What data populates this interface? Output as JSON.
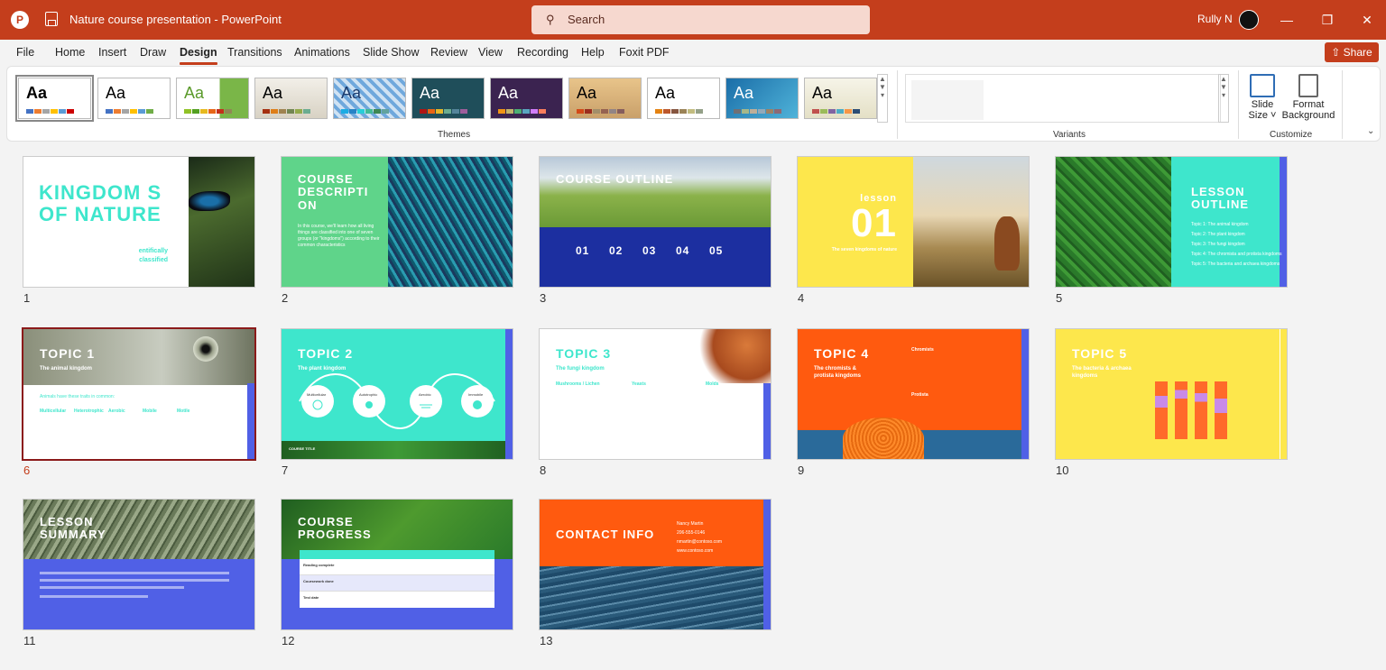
{
  "window": {
    "title": "Nature course presentation  -  PowerPoint",
    "user": "Rully N",
    "search_placeholder": "Search"
  },
  "tabs": [
    "File",
    "Home",
    "Insert",
    "Draw",
    "Design",
    "Transitions",
    "Animations",
    "Slide Show",
    "Review",
    "View",
    "Recording",
    "Help",
    "Foxit PDF"
  ],
  "active_tab": "Design",
  "share_label": "Share",
  "ribbon": {
    "themes_label": "Themes",
    "variants_label": "Variants",
    "customize_label": "Customize",
    "slide_size_label1": "Slide",
    "slide_size_label2": "Size",
    "format_bg_label1": "Format",
    "format_bg_label2": "Background",
    "theme_glyph": "Aa"
  },
  "slides": {
    "s1": {
      "num": "1",
      "title": "KINGDOM S OF NATURE",
      "sub": "entifically classified"
    },
    "s2": {
      "num": "2",
      "title": "COURSE DESCRIPTI ON",
      "body": "In this course, we'll learn how all living things are classified into one of seven groups (or \"kingdoms\") according to their common characteristics"
    },
    "s3": {
      "num": "3",
      "title": "COURSE OUTLINE",
      "items": [
        "01",
        "02",
        "03",
        "04",
        "05"
      ]
    },
    "s4": {
      "num": "4",
      "label": "lesson",
      "number": "01",
      "sub": "The seven kingdoms of nature"
    },
    "s5": {
      "num": "5",
      "title": "LESSON OUTLINE",
      "items": [
        "Topic 1: The animal kingdom",
        "Topic 2: The plant kingdom",
        "Topic 3: The fungi kingdom",
        "Topic 4: The chromista and protista kingdoms",
        "Topic 5: The bacteria and archaea kingdoms"
      ]
    },
    "s6": {
      "num": "6",
      "title": "TOPIC 1",
      "sub": "The animal kingdom",
      "intro": "Animals have these traits in common:",
      "cols": [
        "Multicellular",
        "Heterotrophic",
        "Aerobic",
        "Mobile",
        "Motile"
      ]
    },
    "s7": {
      "num": "7",
      "title": "TOPIC 2",
      "sub": "The plant kingdom",
      "circles": [
        "Multicellular",
        "Autotrophic",
        "Aerobic",
        "Immobile"
      ],
      "footer": "COURSE TITLE"
    },
    "s8": {
      "num": "8",
      "title": "TOPIC 3",
      "sub": "The fungi kingdom",
      "cols": [
        "Mushrooms / Lichen",
        "Yeasts",
        "Molds"
      ]
    },
    "s9": {
      "num": "9",
      "title": "TOPIC 4",
      "sub": "The chromists & protista kingdoms",
      "items": [
        "Chromists",
        "Protista"
      ]
    },
    "s10": {
      "num": "10",
      "title": "TOPIC 5",
      "sub": "The bacteria & archaea kingdoms"
    },
    "s11": {
      "num": "11",
      "title": "LESSON SUMMARY"
    },
    "s12": {
      "num": "12",
      "title": "COURSE PROGRESS",
      "rows": [
        "Reading complete",
        "Coursework done",
        "Test date"
      ]
    },
    "s13": {
      "num": "13",
      "title": "CONTACT INFO",
      "lines": [
        "Nancy Martin",
        "206-555-0146",
        "nmartin@contoso.com",
        "www.contoso.com"
      ]
    }
  },
  "colors": {
    "brand": "#c43e1c",
    "teal": "#3ee6cc",
    "green": "#5fd48a",
    "navy": "#1c2fa0",
    "yellow": "#fde74c",
    "orange": "#ff5a0f",
    "periwinkle": "#5060e6"
  }
}
